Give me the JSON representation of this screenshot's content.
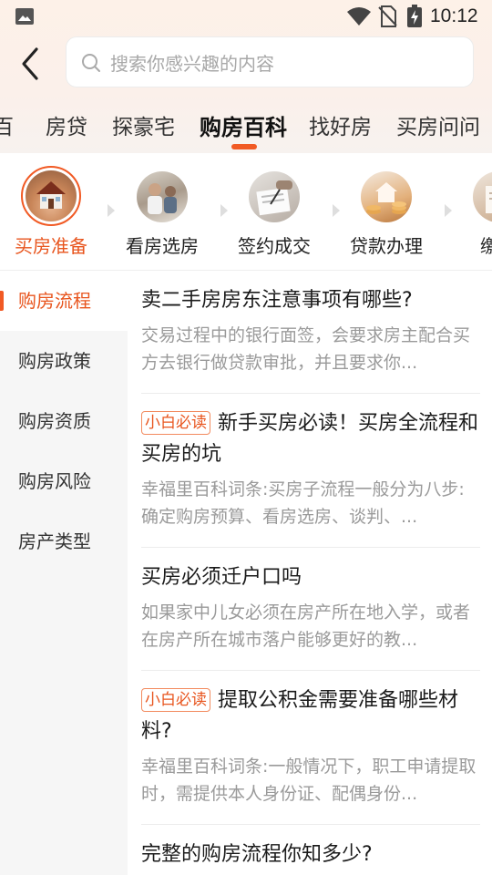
{
  "status_bar": {
    "time": "10:12"
  },
  "search": {
    "placeholder": "搜索你感兴趣的内容"
  },
  "tabs": [
    {
      "label": "百"
    },
    {
      "label": "房贷"
    },
    {
      "label": "探豪宅"
    },
    {
      "label": "购房百科",
      "active": true
    },
    {
      "label": "找好房"
    },
    {
      "label": "买房问问"
    }
  ],
  "categories": [
    {
      "label": "买房准备",
      "icon": "house-in-hand-icon",
      "active": true
    },
    {
      "label": "看房选房",
      "icon": "house-viewing-icon"
    },
    {
      "label": "签约成交",
      "icon": "contract-signing-icon"
    },
    {
      "label": "贷款办理",
      "icon": "coins-house-icon"
    },
    {
      "label": "缴税",
      "icon": "tax-icon"
    }
  ],
  "sidebar": {
    "items": [
      {
        "label": "购房流程",
        "active": true
      },
      {
        "label": "购房政策"
      },
      {
        "label": "购房资质"
      },
      {
        "label": "购房风险"
      },
      {
        "label": "房产类型"
      }
    ]
  },
  "articles": [
    {
      "tag": "",
      "title": "卖二手房房东注意事项有哪些?",
      "desc": "交易过程中的银行面签，会要求房主配合买方去银行做贷款审批，并且要求你..."
    },
    {
      "tag": "小白必读",
      "title": "新手买房必读！买房全流程和买房的坑",
      "desc": "幸福里百科词条:买房子流程一般分为八步:确定购房预算、看房选房、谈判、..."
    },
    {
      "tag": "",
      "title": "买房必须迁户口吗",
      "desc": "如果家中儿女必须在房产所在地入学，或者在房产所在城市落户能够更好的教..."
    },
    {
      "tag": "小白必读",
      "title": "提取公积金需要准备哪些材料?",
      "desc": "幸福里百科词条:一般情况下，职工申请提取时，需提供本人身份证、配偶身份..."
    },
    {
      "tag": "",
      "title": "完整的购房流程你知多少?",
      "desc": ""
    }
  ],
  "colors": {
    "accent": "#f15a24",
    "active_text": "#e8551e"
  }
}
